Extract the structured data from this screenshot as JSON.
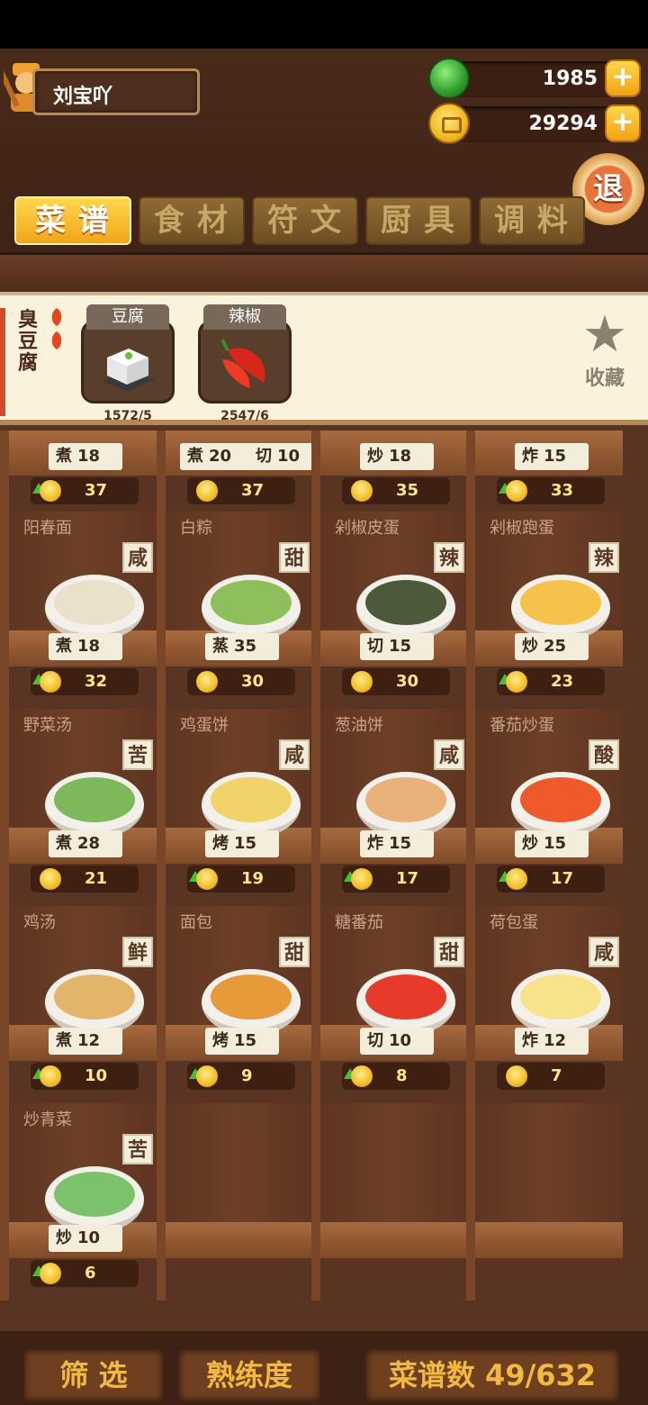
{
  "player": {
    "name": "刘宝吖"
  },
  "resources": {
    "jade": "1985",
    "coins": "29294",
    "plus": "+"
  },
  "exit_label": "退",
  "tabs": [
    "菜谱",
    "食材",
    "符文",
    "厨具",
    "调料"
  ],
  "selected": {
    "dish_name": "臭豆腐",
    "ingredients": [
      {
        "name": "豆腐",
        "count": "1572/5"
      },
      {
        "name": "辣椒",
        "count": "2547/6"
      }
    ],
    "favorite_label": "收藏"
  },
  "top_row": [
    {
      "methods": [
        [
          "煮",
          "18"
        ]
      ],
      "price": "37",
      "up": true
    },
    {
      "methods": [
        [
          "煮",
          "20"
        ],
        [
          "切",
          "10"
        ]
      ],
      "price": "37",
      "up": false
    },
    {
      "methods": [
        [
          "炒",
          "18"
        ]
      ],
      "price": "35",
      "up": false
    },
    {
      "methods": [
        [
          "炸",
          "15"
        ]
      ],
      "price": "33",
      "up": true
    }
  ],
  "recipes": [
    {
      "name": "阳春面",
      "flavor": "咸",
      "method": "煮",
      "time": "18",
      "price": "32",
      "up": true,
      "color": "#e9e2c9"
    },
    {
      "name": "白粽",
      "flavor": "甜",
      "method": "蒸",
      "time": "35",
      "price": "30",
      "up": false,
      "color": "#8fbf5a"
    },
    {
      "name": "剁椒皮蛋",
      "flavor": "辣",
      "method": "切",
      "time": "15",
      "price": "30",
      "up": false,
      "color": "#4d5a3a"
    },
    {
      "name": "剁椒跑蛋",
      "flavor": "辣",
      "method": "炒",
      "time": "25",
      "price": "23",
      "up": true,
      "color": "#f6c24a"
    },
    {
      "name": "野菜汤",
      "flavor": "苦",
      "method": "煮",
      "time": "28",
      "price": "21",
      "up": false,
      "color": "#7bb95a"
    },
    {
      "name": "鸡蛋饼",
      "flavor": "咸",
      "method": "烤",
      "time": "15",
      "price": "19",
      "up": true,
      "color": "#f1d36a"
    },
    {
      "name": "葱油饼",
      "flavor": "咸",
      "method": "炸",
      "time": "15",
      "price": "17",
      "up": true,
      "color": "#e8b27a"
    },
    {
      "name": "番茄炒蛋",
      "flavor": "酸",
      "method": "炒",
      "time": "15",
      "price": "17",
      "up": true,
      "color": "#ef5a2a"
    },
    {
      "name": "鸡汤",
      "flavor": "鲜",
      "method": "煮",
      "time": "12",
      "price": "10",
      "up": true,
      "color": "#e2b56a"
    },
    {
      "name": "面包",
      "flavor": "甜",
      "method": "烤",
      "time": "15",
      "price": "9",
      "up": true,
      "color": "#e69a3a"
    },
    {
      "name": "糖番茄",
      "flavor": "甜",
      "method": "切",
      "time": "10",
      "price": "8",
      "up": true,
      "color": "#e83a2a"
    },
    {
      "name": "荷包蛋",
      "flavor": "咸",
      "method": "炸",
      "time": "12",
      "price": "7",
      "up": false,
      "color": "#f7e38a"
    },
    {
      "name": "炒青菜",
      "flavor": "苦",
      "method": "炒",
      "time": "10",
      "price": "6",
      "up": true,
      "color": "#7bc26a"
    }
  ],
  "bottom": {
    "filter": "筛 选",
    "proficiency": "熟练度",
    "recipe_count": "菜谱数 49/632"
  }
}
